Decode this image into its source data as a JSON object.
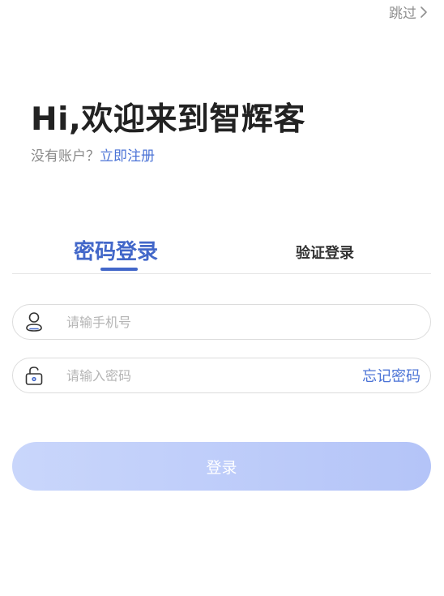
{
  "header": {
    "skip_label": "跳过"
  },
  "welcome": {
    "title": "Hi,欢迎来到智辉客",
    "no_account_text": "没有账户？",
    "signup_link": "立即注册"
  },
  "tabs": [
    {
      "label": "密码登录",
      "active": true
    },
    {
      "label": "验证登录",
      "active": false
    }
  ],
  "form": {
    "phone": {
      "value": "",
      "placeholder": "请输手机号",
      "icon": "user-icon"
    },
    "password": {
      "value": "",
      "placeholder": "请输入密码",
      "icon": "lock-icon"
    },
    "forgot_label": "忘记密码",
    "login_label": "登录"
  },
  "colors": {
    "accent": "#4267c9",
    "link": "#4b73d6",
    "button_start": "#c9d6fb",
    "button_end": "#b4c4f8"
  }
}
